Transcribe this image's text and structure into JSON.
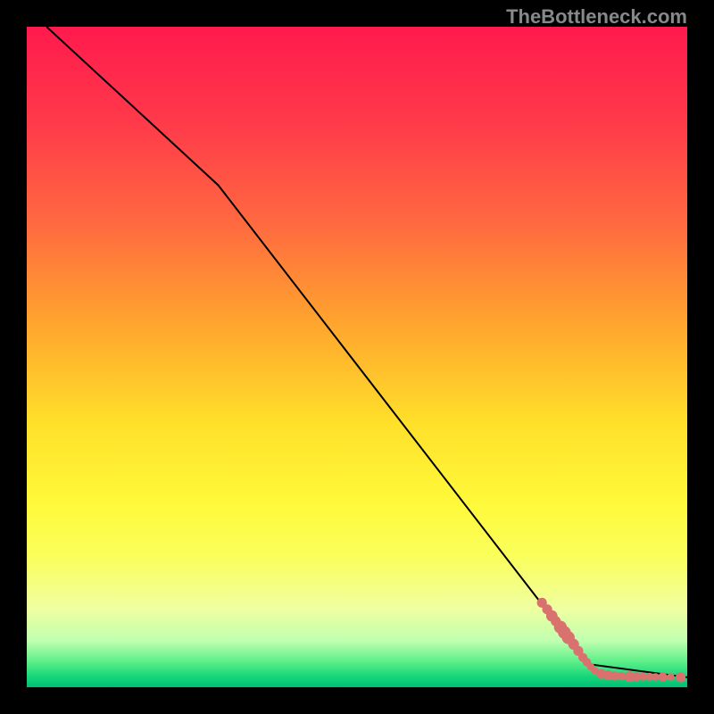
{
  "watermark": "TheBottleneck.com",
  "chart_data": {
    "type": "line",
    "title": "",
    "xlabel": "",
    "ylabel": "",
    "xrange": [
      0,
      100
    ],
    "yrange": [
      0,
      100
    ],
    "background_gradient_stops": [
      {
        "offset": 0.0,
        "color": "#ff1a4d"
      },
      {
        "offset": 0.15,
        "color": "#ff3b4a"
      },
      {
        "offset": 0.3,
        "color": "#ff6a40"
      },
      {
        "offset": 0.45,
        "color": "#ffa52e"
      },
      {
        "offset": 0.6,
        "color": "#ffe02a"
      },
      {
        "offset": 0.72,
        "color": "#fff93a"
      },
      {
        "offset": 0.8,
        "color": "#faff5a"
      },
      {
        "offset": 0.88,
        "color": "#f0ffa0"
      },
      {
        "offset": 0.93,
        "color": "#c0ffb0"
      },
      {
        "offset": 0.96,
        "color": "#60f08a"
      },
      {
        "offset": 0.985,
        "color": "#14d47a"
      },
      {
        "offset": 1.0,
        "color": "#00c074"
      }
    ],
    "curve": [
      {
        "x": 3.0,
        "y": 100.0
      },
      {
        "x": 29.0,
        "y": 76.0
      },
      {
        "x": 85.0,
        "y": 3.5
      },
      {
        "x": 100.0,
        "y": 1.5
      }
    ],
    "scatter_points": [
      {
        "x": 78.0,
        "y": 12.8,
        "r": 3.5
      },
      {
        "x": 78.8,
        "y": 11.8,
        "r": 3.5
      },
      {
        "x": 79.5,
        "y": 10.8,
        "r": 4.0
      },
      {
        "x": 80.1,
        "y": 10.0,
        "r": 3.5
      },
      {
        "x": 80.8,
        "y": 9.1,
        "r": 4.5
      },
      {
        "x": 81.4,
        "y": 8.3,
        "r": 4.5
      },
      {
        "x": 82.0,
        "y": 7.5,
        "r": 4.5
      },
      {
        "x": 82.8,
        "y": 6.5,
        "r": 3.8
      },
      {
        "x": 83.5,
        "y": 5.5,
        "r": 3.5
      },
      {
        "x": 84.2,
        "y": 4.5,
        "r": 3.2
      },
      {
        "x": 84.8,
        "y": 3.8,
        "r": 3.0
      },
      {
        "x": 85.4,
        "y": 3.1,
        "r": 2.6
      },
      {
        "x": 86.0,
        "y": 2.5,
        "r": 2.6
      },
      {
        "x": 87.0,
        "y": 2.0,
        "r": 3.5
      },
      {
        "x": 88.0,
        "y": 1.8,
        "r": 3.5
      },
      {
        "x": 89.0,
        "y": 1.7,
        "r": 3.2
      },
      {
        "x": 90.0,
        "y": 1.7,
        "r": 3.0
      },
      {
        "x": 91.3,
        "y": 1.6,
        "r": 3.8
      },
      {
        "x": 92.3,
        "y": 1.6,
        "r": 3.2
      },
      {
        "x": 93.3,
        "y": 1.6,
        "r": 2.8
      },
      {
        "x": 94.3,
        "y": 1.6,
        "r": 2.8
      },
      {
        "x": 95.2,
        "y": 1.55,
        "r": 2.6
      },
      {
        "x": 96.3,
        "y": 1.55,
        "r": 3.2
      },
      {
        "x": 97.5,
        "y": 1.55,
        "r": 2.6
      },
      {
        "x": 99.0,
        "y": 1.5,
        "r": 3.5
      }
    ],
    "scatter_color": "#d9726e",
    "curve_color": "#000000"
  }
}
